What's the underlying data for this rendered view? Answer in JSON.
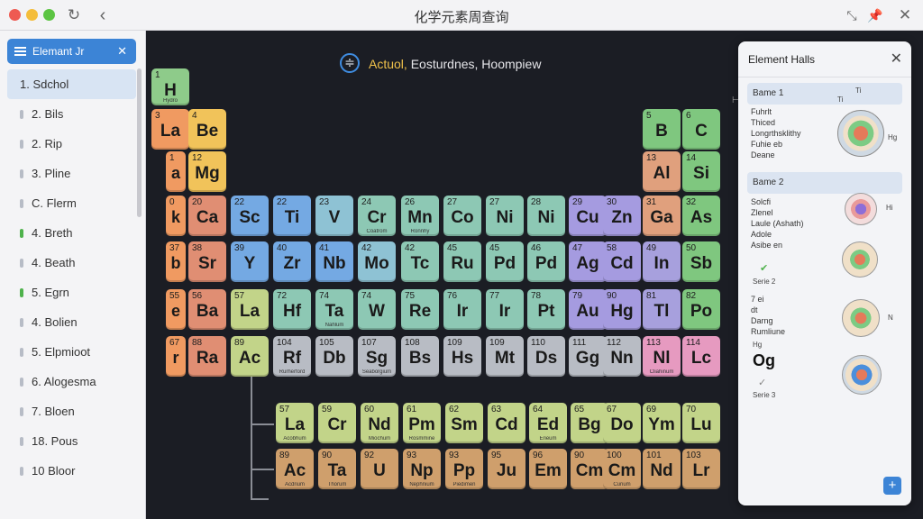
{
  "window": {
    "title": "化学元素周查询"
  },
  "toolbar": {
    "refresh_icon": "refresh-icon",
    "back_icon": "back-icon",
    "pin_icon": "pin-icon",
    "close_icon": "close-icon"
  },
  "sidebar": {
    "search_value": "Elemant Jr",
    "items": [
      {
        "label": "1. Sdchol"
      },
      {
        "label": "2. Bils"
      },
      {
        "label": "2. Rip"
      },
      {
        "label": "3. Pline"
      },
      {
        "label": "C. Flerm"
      },
      {
        "label": "4. Breth"
      },
      {
        "label": "4. Beath"
      },
      {
        "label": "5. Egrn"
      },
      {
        "label": "4. Bolien"
      },
      {
        "label": "5. Elpmioot"
      },
      {
        "label": "6. Alogesma"
      },
      {
        "label": "7. Bloen"
      },
      {
        "label": "18. Pous"
      },
      {
        "label": "10 Bloor"
      }
    ]
  },
  "main": {
    "title_highlight": "Actuol,",
    "title_rest": " Eosturdnes, Hoompiew",
    "elements": [
      {
        "num": "1",
        "sym": "H",
        "nm": "Hydro",
        "color": "#8ecb8a"
      },
      {
        "num": "3",
        "sym": "La",
        "nm": "",
        "color": "#f09a61"
      },
      {
        "num": "4",
        "sym": "Be",
        "nm": "",
        "color": "#f1c35a"
      },
      {
        "num": "5",
        "sym": "B",
        "nm": "",
        "color": "#7fc77f"
      },
      {
        "num": "6",
        "sym": "C",
        "nm": "",
        "color": "#7fc77f"
      },
      {
        "num": "1",
        "sym": "a",
        "nm": "",
        "color": "#f09a61"
      },
      {
        "num": "12",
        "sym": "Mg",
        "nm": "",
        "color": "#f1c35a"
      },
      {
        "num": "13",
        "sym": "Al",
        "nm": "",
        "color": "#e0a07d"
      },
      {
        "num": "14",
        "sym": "Si",
        "nm": "",
        "color": "#7fc77f"
      },
      {
        "num": "0",
        "sym": "k",
        "nm": "",
        "color": "#f09a61"
      },
      {
        "num": "20",
        "sym": "Ca",
        "nm": "",
        "color": "#e08e73"
      },
      {
        "num": "22",
        "sym": "Sc",
        "nm": "",
        "color": "#74a9e3"
      },
      {
        "num": "22",
        "sym": "Ti",
        "nm": "",
        "color": "#74a9e3"
      },
      {
        "num": "23",
        "sym": "V",
        "nm": "",
        "color": "#8ec2d4"
      },
      {
        "num": "24",
        "sym": "Cr",
        "nm": "Coatrom",
        "color": "#8dc8b4"
      },
      {
        "num": "26",
        "sym": "Mn",
        "nm": "Ronnhy",
        "color": "#8dc8b4"
      },
      {
        "num": "27",
        "sym": "Co",
        "nm": "",
        "color": "#8dc8b4"
      },
      {
        "num": "27",
        "sym": "Ni",
        "nm": "",
        "color": "#8dc8b4"
      },
      {
        "num": "28",
        "sym": "Ni",
        "nm": "",
        "color": "#8dc8b4"
      },
      {
        "num": "29",
        "sym": "Cu",
        "nm": "",
        "color": "#a59be0"
      },
      {
        "num": "30",
        "sym": "Zn",
        "nm": "",
        "color": "#a59be0"
      },
      {
        "num": "31",
        "sym": "Ga",
        "nm": "",
        "color": "#e0a07d"
      },
      {
        "num": "32",
        "sym": "As",
        "nm": "",
        "color": "#7fc77f"
      },
      {
        "num": "37",
        "sym": "b",
        "nm": "",
        "color": "#f09a61"
      },
      {
        "num": "38",
        "sym": "Sr",
        "nm": "",
        "color": "#e08e73"
      },
      {
        "num": "39",
        "sym": "Y",
        "nm": "",
        "color": "#74a9e3"
      },
      {
        "num": "40",
        "sym": "Zr",
        "nm": "",
        "color": "#74a9e3"
      },
      {
        "num": "41",
        "sym": "Nb",
        "nm": "",
        "color": "#74a9e3"
      },
      {
        "num": "42",
        "sym": "Mo",
        "nm": "",
        "color": "#8ec2d4"
      },
      {
        "num": "42",
        "sym": "Tc",
        "nm": "",
        "color": "#8dc8b4"
      },
      {
        "num": "45",
        "sym": "Ru",
        "nm": "",
        "color": "#8dc8b4"
      },
      {
        "num": "45",
        "sym": "Pd",
        "nm": "",
        "color": "#8dc8b4"
      },
      {
        "num": "46",
        "sym": "Pd",
        "nm": "",
        "color": "#8dc8b4"
      },
      {
        "num": "47",
        "sym": "Ag",
        "nm": "",
        "color": "#a59be0"
      },
      {
        "num": "58",
        "sym": "Cd",
        "nm": "",
        "color": "#a59be0"
      },
      {
        "num": "49",
        "sym": "In",
        "nm": "",
        "color": "#a7a0dd"
      },
      {
        "num": "50",
        "sym": "Sb",
        "nm": "",
        "color": "#7fc77f"
      },
      {
        "num": "55",
        "sym": "e",
        "nm": "",
        "color": "#f09a61"
      },
      {
        "num": "56",
        "sym": "Ba",
        "nm": "",
        "color": "#e08e73"
      },
      {
        "num": "57",
        "sym": "La",
        "nm": "",
        "color": "#c2d489"
      },
      {
        "num": "72",
        "sym": "Hf",
        "nm": "",
        "color": "#8dc8b4"
      },
      {
        "num": "74",
        "sym": "Ta",
        "nm": "Nahlum",
        "color": "#8dc8b4"
      },
      {
        "num": "74",
        "sym": "W",
        "nm": "",
        "color": "#8dc8b4"
      },
      {
        "num": "75",
        "sym": "Re",
        "nm": "",
        "color": "#8dc8b4"
      },
      {
        "num": "76",
        "sym": "Ir",
        "nm": "",
        "color": "#8dc8b4"
      },
      {
        "num": "77",
        "sym": "Ir",
        "nm": "",
        "color": "#8dc8b4"
      },
      {
        "num": "78",
        "sym": "Pt",
        "nm": "",
        "color": "#8dc8b4"
      },
      {
        "num": "79",
        "sym": "Au",
        "nm": "",
        "color": "#a59be0"
      },
      {
        "num": "90",
        "sym": "Hg",
        "nm": "",
        "color": "#a59be0"
      },
      {
        "num": "81",
        "sym": "Tl",
        "nm": "",
        "color": "#a7a0dd"
      },
      {
        "num": "82",
        "sym": "Po",
        "nm": "",
        "color": "#7fc77f"
      },
      {
        "num": "67",
        "sym": "r",
        "nm": "",
        "color": "#f09a61"
      },
      {
        "num": "88",
        "sym": "Ra",
        "nm": "",
        "color": "#e08e73"
      },
      {
        "num": "89",
        "sym": "Ac",
        "nm": "",
        "color": "#c2d489"
      },
      {
        "num": "104",
        "sym": "Rf",
        "nm": "Rurherford",
        "color": "#b8bcc4"
      },
      {
        "num": "105",
        "sym": "Db",
        "nm": "",
        "color": "#b8bcc4"
      },
      {
        "num": "107",
        "sym": "Sg",
        "nm": "Seaborgium",
        "color": "#b8bcc4"
      },
      {
        "num": "108",
        "sym": "Bs",
        "nm": "",
        "color": "#b8bcc4"
      },
      {
        "num": "109",
        "sym": "Hs",
        "nm": "",
        "color": "#b8bcc4"
      },
      {
        "num": "109",
        "sym": "Mt",
        "nm": "",
        "color": "#b8bcc4"
      },
      {
        "num": "110",
        "sym": "Ds",
        "nm": "",
        "color": "#b8bcc4"
      },
      {
        "num": "111",
        "sym": "Gg",
        "nm": "",
        "color": "#b8bcc4"
      },
      {
        "num": "112",
        "sym": "Nn",
        "nm": "",
        "color": "#b8bcc4"
      },
      {
        "num": "113",
        "sym": "Nl",
        "nm": "Cliahinum",
        "color": "#e69ac0"
      },
      {
        "num": "114",
        "sym": "Lc",
        "nm": "",
        "color": "#e69ac0"
      },
      {
        "num": "57",
        "sym": "La",
        "nm": "Acobhum",
        "color": "#c2d489"
      },
      {
        "num": "59",
        "sym": "Cr",
        "nm": "",
        "color": "#c2d489"
      },
      {
        "num": "60",
        "sym": "Nd",
        "nm": "Miochum",
        "color": "#c2d489"
      },
      {
        "num": "61",
        "sym": "Pm",
        "nm": "Rosmmine",
        "color": "#c2d489"
      },
      {
        "num": "62",
        "sym": "Sm",
        "nm": "",
        "color": "#c2d489"
      },
      {
        "num": "63",
        "sym": "Cd",
        "nm": "",
        "color": "#c2d489"
      },
      {
        "num": "64",
        "sym": "Ed",
        "nm": "Erieum",
        "color": "#c2d489"
      },
      {
        "num": "65",
        "sym": "Bg",
        "nm": "",
        "color": "#c2d489"
      },
      {
        "num": "67",
        "sym": "Do",
        "nm": "",
        "color": "#c2d489"
      },
      {
        "num": "69",
        "sym": "Ym",
        "nm": "",
        "color": "#c2d489"
      },
      {
        "num": "70",
        "sym": "Lu",
        "nm": "",
        "color": "#c2d489"
      },
      {
        "num": "89",
        "sym": "Ac",
        "nm": "Acdrium",
        "color": "#cf9f6c"
      },
      {
        "num": "90",
        "sym": "Ta",
        "nm": "Thorum",
        "color": "#cf9f6c"
      },
      {
        "num": "92",
        "sym": "U",
        "nm": "",
        "color": "#cf9f6c"
      },
      {
        "num": "93",
        "sym": "Np",
        "nm": "Nephnium",
        "color": "#cf9f6c"
      },
      {
        "num": "93",
        "sym": "Pp",
        "nm": "Piedimen",
        "color": "#cf9f6c"
      },
      {
        "num": "95",
        "sym": "Ju",
        "nm": "",
        "color": "#cf9f6c"
      },
      {
        "num": "96",
        "sym": "Em",
        "nm": "",
        "color": "#cf9f6c"
      },
      {
        "num": "90",
        "sym": "Cm",
        "nm": "",
        "color": "#cf9f6c"
      },
      {
        "num": "100",
        "sym": "Cm",
        "nm": "Curium",
        "color": "#cf9f6c"
      },
      {
        "num": "101",
        "sym": "Nd",
        "nm": "",
        "color": "#cf9f6c"
      },
      {
        "num": "103",
        "sym": "Lr",
        "nm": "",
        "color": "#cf9f6c"
      }
    ]
  },
  "panel": {
    "title": "Element Halls",
    "group1": {
      "label": "Bame 1",
      "mini_left": "Ti",
      "mini_right": "Ti",
      "fields": [
        "Fuhrlt",
        "Thiced",
        "Longrthsklithy",
        "Fuhie eb",
        "Deane"
      ],
      "side": "Hg"
    },
    "group2": {
      "label": "Bame 2",
      "fields": [
        "Solcfi",
        "Zlenel",
        "Laule (Ashath)",
        "Adole",
        "Asibe en"
      ],
      "side": "Hi"
    },
    "series2": "Serie 2",
    "block3": {
      "fields": [
        "7 ei",
        "dt",
        "Darng",
        "Rumliune"
      ],
      "side": "N"
    },
    "og_num": "Hg",
    "og_sym": "Og",
    "series3": "Serie 3"
  }
}
